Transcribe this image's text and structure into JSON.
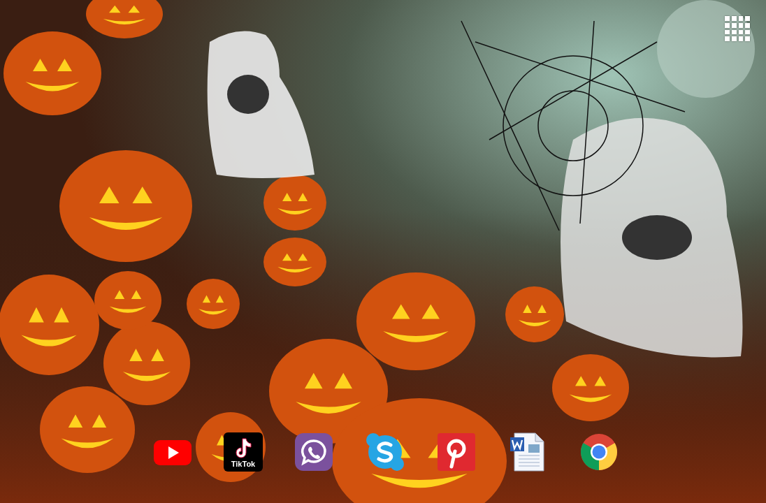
{
  "dock": {
    "apps": [
      {
        "kind": "play"
      },
      {
        "kind": "note",
        "label": "TikTok"
      },
      {
        "kind": "phone"
      },
      {
        "kind": "cloud"
      },
      {
        "kind": "pin"
      },
      {
        "kind": "document"
      },
      {
        "kind": "browser"
      }
    ]
  }
}
